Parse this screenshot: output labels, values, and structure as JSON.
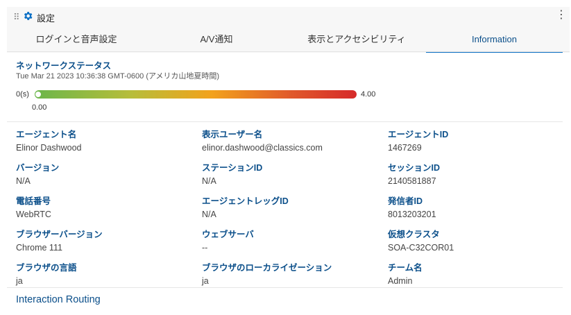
{
  "header": {
    "title": "設定",
    "tabs": [
      {
        "label": "ログインと音声設定",
        "active": false
      },
      {
        "label": "A/V通知",
        "active": false
      },
      {
        "label": "表示とアクセシビリティ",
        "active": false
      },
      {
        "label": "Information",
        "active": true
      }
    ]
  },
  "network": {
    "title": "ネットワークステータス",
    "timestamp": "Tue Mar 21 2023 10:36:38 GMT-0600 (アメリカ山地夏時間)",
    "min_label": "0(s)",
    "max_label": "4.00",
    "current_value": "0.00",
    "level": 0.0
  },
  "fields": [
    {
      "label": "エージェント名",
      "value": "Elinor Dashwood"
    },
    {
      "label": "表示ユーザー名",
      "value": "elinor.dashwood@classics.com"
    },
    {
      "label": "エージェントID",
      "value": "1467269"
    },
    {
      "label": "バージョン",
      "value": "N/A"
    },
    {
      "label": "ステーションID",
      "value": "N/A"
    },
    {
      "label": "セッションID",
      "value": "2140581887"
    },
    {
      "label": "電話番号",
      "value": "WebRTC"
    },
    {
      "label": "エージェントレッグID",
      "value": "N/A"
    },
    {
      "label": "発信者ID",
      "value": "8013203201"
    },
    {
      "label": "ブラウザーバージョン",
      "value": "Chrome 111"
    },
    {
      "label": "ウェブサーバ",
      "value": "--"
    },
    {
      "label": "仮想クラスタ",
      "value": "SOA-C32COR01"
    },
    {
      "label": "ブラウザの言語",
      "value": "ja"
    },
    {
      "label": "ブラウザのローカライゼーション",
      "value": "ja"
    },
    {
      "label": "チーム名",
      "value": "Admin"
    }
  ],
  "routing": {
    "title": "Interaction Routing"
  },
  "colors": {
    "accent": "#0b4f8a",
    "tab_underline": "#0b6fc5"
  },
  "icons": [
    "drag-handle-icon",
    "gear-icon",
    "more-vertical-icon"
  ]
}
